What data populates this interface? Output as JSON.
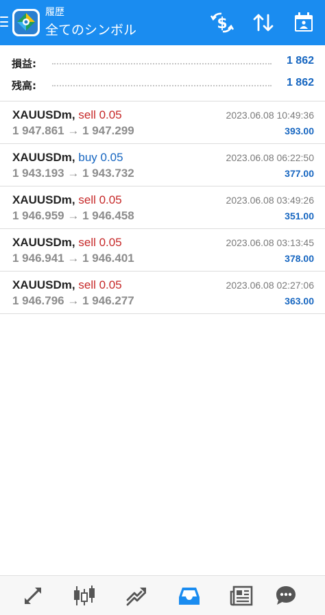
{
  "header": {
    "subtitle": "履歴",
    "title": "全てのシンボル",
    "brand_color": "#1a8cf0",
    "buttons": [
      "currency-exchange-icon",
      "sort-icon",
      "calendar-icon"
    ]
  },
  "summary": {
    "profit_label": "損益:",
    "profit_value": "1 862",
    "balance_label": "残高:",
    "balance_value": "1 862"
  },
  "deals": [
    {
      "symbol": "XAUUSDm,",
      "type": "sell 0.05",
      "side": "sell",
      "open_price": "1 947.861",
      "arrow": "→",
      "close_price": "1 947.299",
      "time": "2023.06.08 10:49:36",
      "profit": "393.00"
    },
    {
      "symbol": "XAUUSDm,",
      "type": "buy 0.05",
      "side": "buy",
      "open_price": "1 943.193",
      "arrow": "→",
      "close_price": "1 943.732",
      "time": "2023.06.08 06:22:50",
      "profit": "377.00"
    },
    {
      "symbol": "XAUUSDm,",
      "type": "sell 0.05",
      "side": "sell",
      "open_price": "1 946.959",
      "arrow": "→",
      "close_price": "1 946.458",
      "time": "2023.06.08 03:49:26",
      "profit": "351.00"
    },
    {
      "symbol": "XAUUSDm,",
      "type": "sell 0.05",
      "side": "sell",
      "open_price": "1 946.941",
      "arrow": "→",
      "close_price": "1 946.401",
      "time": "2023.06.08 03:13:45",
      "profit": "378.00"
    },
    {
      "symbol": "XAUUSDm,",
      "type": "sell 0.05",
      "side": "sell",
      "open_price": "1 946.796",
      "arrow": "→",
      "close_price": "1 946.277",
      "time": "2023.06.08 02:27:06",
      "profit": "363.00"
    }
  ],
  "bottom_nav": {
    "items": [
      "quotes-icon",
      "chart-icon",
      "trade-icon",
      "history-icon",
      "news-icon",
      "chat-icon"
    ],
    "active": "history-icon",
    "active_color": "#1a8cf0",
    "inactive_color": "#555555"
  }
}
